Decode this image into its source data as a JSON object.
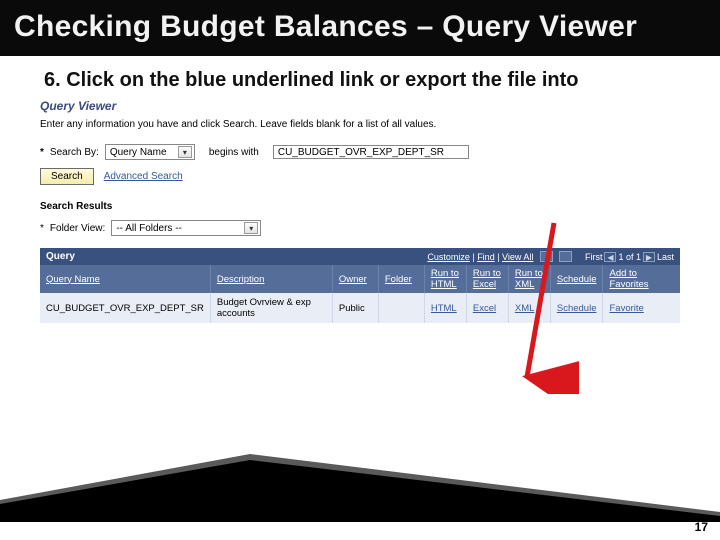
{
  "title": "Checking Budget Balances – Query Viewer",
  "step_text": "6. Click on the blue underlined link or export the file into",
  "qv": {
    "heading": "Query Viewer",
    "instruction": "Enter any information you have and click Search. Leave fields blank for a list of all values.",
    "search_by_label": "Search By:",
    "search_by_value": "Query Name",
    "begins_with": "begins with",
    "search_value": "CU_BUDGET_OVR_EXP_DEPT_SR",
    "search_btn": "Search",
    "advanced": "Advanced Search",
    "search_results": "Search Results",
    "folder_view_label": "Folder View:",
    "folder_view_value": "-- All Folders --"
  },
  "grid": {
    "top_label": "Query",
    "toolbar": {
      "customize": "Customize",
      "find": "Find",
      "view_all": "View All",
      "first": "First",
      "count": "1 of 1",
      "last": "Last"
    },
    "headers": {
      "query_name": "Query Name",
      "description": "Description",
      "owner": "Owner",
      "folder": "Folder",
      "run_html": "Run to HTML",
      "run_excel": "Run to Excel",
      "run_xml": "Run to XML",
      "schedule": "Schedule",
      "add_fav": "Add to Favorites"
    },
    "row": {
      "query_name": "CU_BUDGET_OVR_EXP_DEPT_SR",
      "description": "Budget Ovrview & exp accounts",
      "owner": "Public",
      "folder": "",
      "html": "HTML",
      "excel": "Excel",
      "xml": "XML",
      "schedule": "Schedule",
      "favorite": "Favorite"
    }
  },
  "page_number": "17"
}
